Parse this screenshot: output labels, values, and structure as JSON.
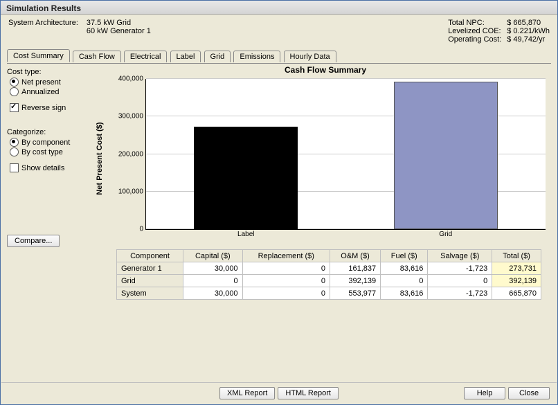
{
  "window": {
    "title": "Simulation Results"
  },
  "header": {
    "arch_label": "System Architecture:",
    "arch_line1": "37.5 kW Grid",
    "arch_line2": "60 kW Generator 1",
    "npc_label": "Total NPC:",
    "npc_value": "$ 665,870",
    "coe_label": "Levelized COE:",
    "coe_value": "$ 0.221/kWh",
    "op_label": "Operating Cost:",
    "op_value": "$ 49,742/yr"
  },
  "tabs": [
    "Cost Summary",
    "Cash Flow",
    "Electrical",
    "Label",
    "Grid",
    "Emissions",
    "Hourly Data"
  ],
  "controls": {
    "cost_type_label": "Cost type:",
    "net_present": "Net present",
    "annualized": "Annualized",
    "reverse_sign": "Reverse sign",
    "categorize_label": "Categorize:",
    "by_component": "By component",
    "by_cost_type": "By cost type",
    "show_details": "Show details",
    "compare": "Compare..."
  },
  "chart": {
    "title": "Cash Flow Summary",
    "y_title": "Net Present Cost ($)"
  },
  "chart_data": {
    "type": "bar",
    "categories": [
      "Label",
      "Grid"
    ],
    "values": [
      273731,
      392139
    ],
    "title": "Cash Flow Summary",
    "xlabel": "",
    "ylabel": "Net Present Cost ($)",
    "ylim": [
      0,
      400000
    ],
    "yticks": [
      0,
      100000,
      200000,
      300000,
      400000
    ],
    "ytick_labels": [
      "0",
      "100,000",
      "200,000",
      "300,000",
      "400,000"
    ],
    "colors": [
      "#000000",
      "#8e95c4"
    ]
  },
  "table": {
    "headers": [
      "Component",
      "Capital ($)",
      "Replacement ($)",
      "O&M ($)",
      "Fuel ($)",
      "Salvage ($)",
      "Total ($)"
    ],
    "rows": [
      {
        "label": "Generator 1",
        "cells": [
          "30,000",
          "0",
          "161,837",
          "83,616",
          "-1,723",
          "273,731"
        ],
        "hl": true
      },
      {
        "label": "Grid",
        "cells": [
          "0",
          "0",
          "392,139",
          "0",
          "0",
          "392,139"
        ],
        "hl": true
      },
      {
        "label": "System",
        "cells": [
          "30,000",
          "0",
          "553,977",
          "83,616",
          "-1,723",
          "665,870"
        ],
        "hl": false
      }
    ]
  },
  "footer": {
    "xml": "XML Report",
    "html": "HTML Report",
    "help": "Help",
    "close": "Close"
  }
}
